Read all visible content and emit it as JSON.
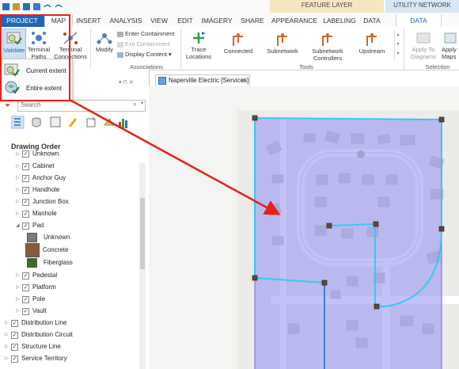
{
  "contextual": {
    "feature_layer": "FEATURE LAYER",
    "utility_network": "UTILITY NETWORK"
  },
  "tabs": [
    "PROJECT",
    "MAP",
    "INSERT",
    "ANALYSIS",
    "VIEW",
    "EDIT",
    "IMAGERY",
    "SHARE",
    "APPEARANCE",
    "LABELING",
    "DATA",
    "DATA"
  ],
  "ribbon": {
    "validate": {
      "label": "Validate"
    },
    "terminal_paths": {
      "line1": "Terminal",
      "line2": "Paths"
    },
    "terminal_connections": {
      "line1": "Terminal",
      "line2": "Connections"
    },
    "modify": "Modify",
    "enter_containment": "Enter Containment",
    "exit_containment": "Exit Containment",
    "display_content": "Display Content",
    "associations_group": "Associations",
    "trace_locations": {
      "line1": "Trace",
      "line2": "Locations"
    },
    "tools": [
      "Connected",
      "Subnetwork",
      "Subnetwork Controllers",
      "Upstream"
    ],
    "tools_group": "Tools",
    "apply_to_diagrams": {
      "line1": "Apply To",
      "line2": "Diagrams"
    },
    "apply_maps": {
      "line1": "Apply",
      "line2": "Maps"
    },
    "selection_group": "Selection"
  },
  "validate_menu": {
    "items": [
      "Current extent",
      "Entire extent"
    ]
  },
  "contents": {
    "search_placeholder": "Search",
    "drawing_order": "Drawing Order",
    "partial_item": "Unknown",
    "items": [
      "Cabinet",
      "Anchor Guy",
      "Handhole",
      "Junction Box",
      "Manhole"
    ],
    "pad": {
      "label": "Pad",
      "legend": [
        {
          "label": "Unknown",
          "color": "#7a7a7a"
        },
        {
          "label": "Concrete",
          "color": "#8b5a3c"
        },
        {
          "label": "Fiberglass",
          "color": "#3f6d1f"
        }
      ]
    },
    "items2": [
      "Pedestal",
      "Platform",
      "Pole",
      "Vault"
    ],
    "items3": [
      "Distribution Line",
      "Distribution Circuit",
      "Structure Line",
      "Service Territory"
    ]
  },
  "map": {
    "tab_title": "Naperville Electric [Services]",
    "extent_color": "#8f8ff0",
    "line_color": "#36c8f0"
  },
  "colors": {
    "annotation_red": "#e2231a",
    "project_tab": "#1f66b9"
  }
}
